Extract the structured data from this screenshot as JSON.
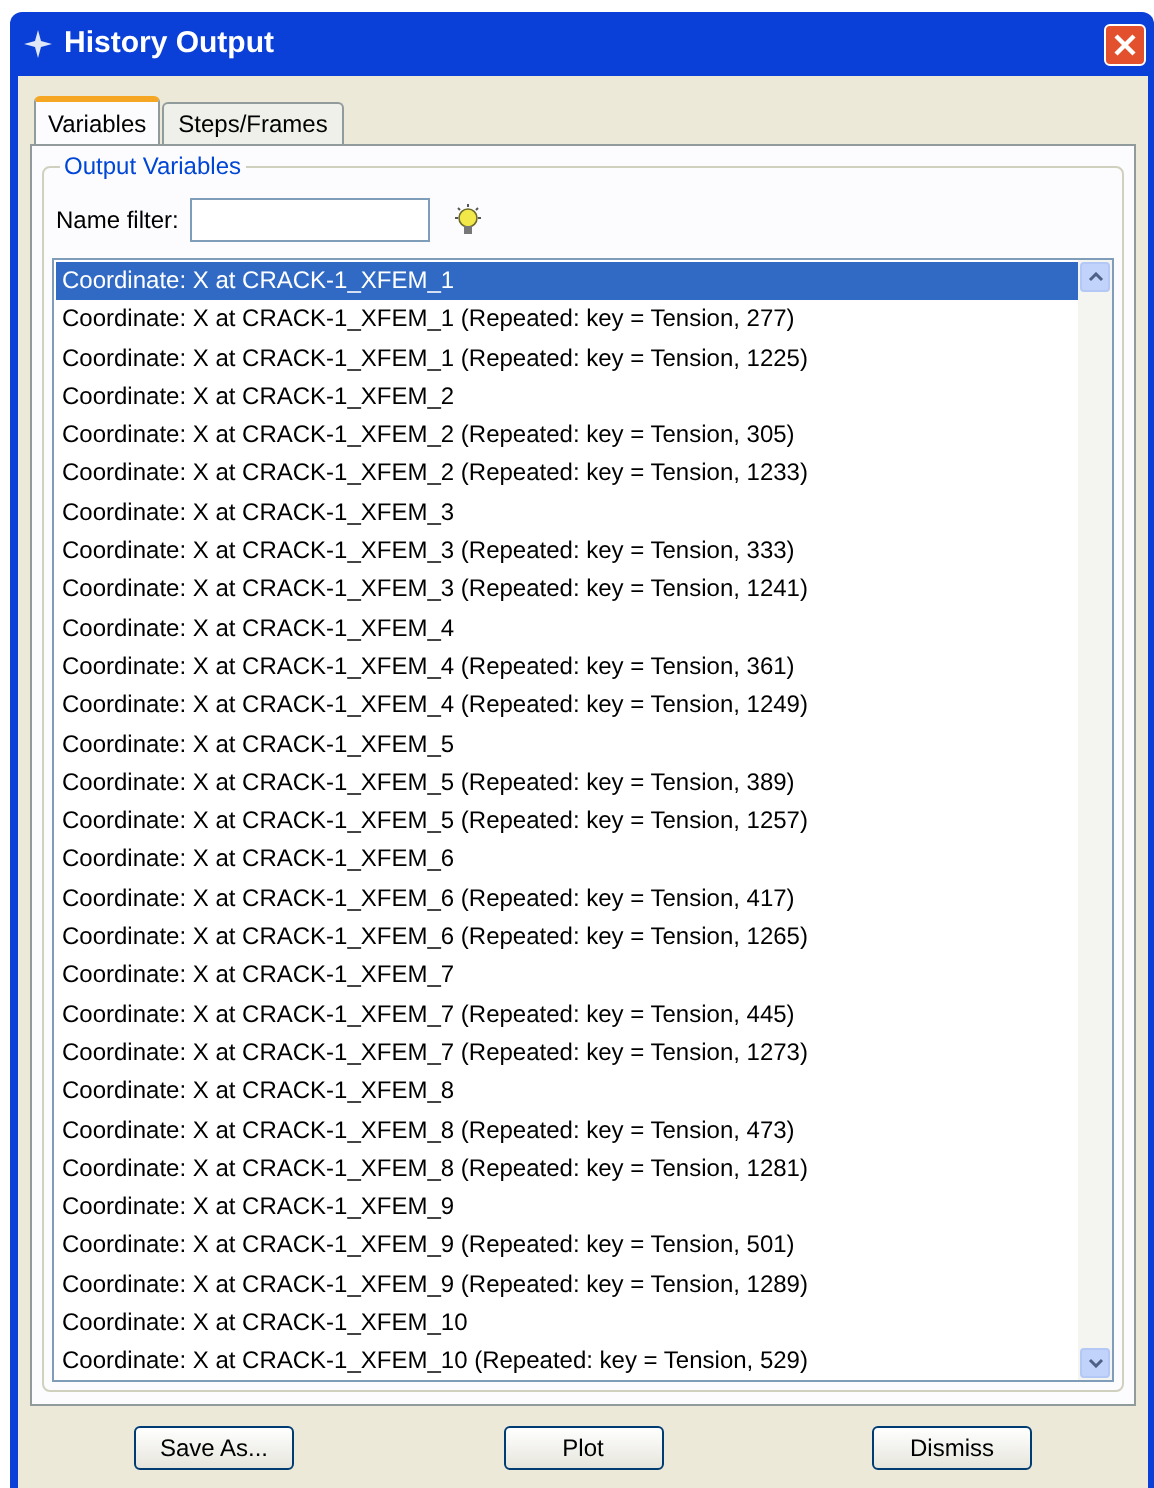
{
  "window": {
    "title": "History Output"
  },
  "tabs": [
    {
      "label": "Variables",
      "selected": true
    },
    {
      "label": "Steps/Frames",
      "selected": false
    }
  ],
  "group": {
    "title": "Output Variables"
  },
  "name_filter": {
    "label": "Name filter:"
  },
  "list": [
    {
      "text": "Coordinate: X at CRACK-1_XFEM_1",
      "selected": true
    },
    {
      "text": "Coordinate: X at CRACK-1_XFEM_1 (Repeated: key = Tension, 277)",
      "selected": false
    },
    {
      "text": "Coordinate: X at CRACK-1_XFEM_1 (Repeated: key = Tension, 1225)",
      "selected": false
    },
    {
      "text": "Coordinate: X at CRACK-1_XFEM_2",
      "selected": false
    },
    {
      "text": "Coordinate: X at CRACK-1_XFEM_2 (Repeated: key = Tension, 305)",
      "selected": false
    },
    {
      "text": "Coordinate: X at CRACK-1_XFEM_2 (Repeated: key = Tension, 1233)",
      "selected": false
    },
    {
      "text": "Coordinate: X at CRACK-1_XFEM_3",
      "selected": false
    },
    {
      "text": "Coordinate: X at CRACK-1_XFEM_3 (Repeated: key = Tension, 333)",
      "selected": false
    },
    {
      "text": "Coordinate: X at CRACK-1_XFEM_3 (Repeated: key = Tension, 1241)",
      "selected": false
    },
    {
      "text": "Coordinate: X at CRACK-1_XFEM_4",
      "selected": false
    },
    {
      "text": "Coordinate: X at CRACK-1_XFEM_4 (Repeated: key = Tension, 361)",
      "selected": false
    },
    {
      "text": "Coordinate: X at CRACK-1_XFEM_4 (Repeated: key = Tension, 1249)",
      "selected": false
    },
    {
      "text": "Coordinate: X at CRACK-1_XFEM_5",
      "selected": false
    },
    {
      "text": "Coordinate: X at CRACK-1_XFEM_5 (Repeated: key = Tension, 389)",
      "selected": false
    },
    {
      "text": "Coordinate: X at CRACK-1_XFEM_5 (Repeated: key = Tension, 1257)",
      "selected": false
    },
    {
      "text": "Coordinate: X at CRACK-1_XFEM_6",
      "selected": false
    },
    {
      "text": "Coordinate: X at CRACK-1_XFEM_6 (Repeated: key = Tension, 417)",
      "selected": false
    },
    {
      "text": "Coordinate: X at CRACK-1_XFEM_6 (Repeated: key = Tension, 1265)",
      "selected": false
    },
    {
      "text": "Coordinate: X at CRACK-1_XFEM_7",
      "selected": false
    },
    {
      "text": "Coordinate: X at CRACK-1_XFEM_7 (Repeated: key = Tension, 445)",
      "selected": false
    },
    {
      "text": "Coordinate: X at CRACK-1_XFEM_7 (Repeated: key = Tension, 1273)",
      "selected": false
    },
    {
      "text": "Coordinate: X at CRACK-1_XFEM_8",
      "selected": false
    },
    {
      "text": "Coordinate: X at CRACK-1_XFEM_8 (Repeated: key = Tension, 473)",
      "selected": false
    },
    {
      "text": "Coordinate: X at CRACK-1_XFEM_8 (Repeated: key = Tension, 1281)",
      "selected": false
    },
    {
      "text": "Coordinate: X at CRACK-1_XFEM_9",
      "selected": false
    },
    {
      "text": "Coordinate: X at CRACK-1_XFEM_9 (Repeated: key = Tension, 501)",
      "selected": false
    },
    {
      "text": "Coordinate: X at CRACK-1_XFEM_9 (Repeated: key = Tension, 1289)",
      "selected": false
    },
    {
      "text": "Coordinate: X at CRACK-1_XFEM_10",
      "selected": false
    },
    {
      "text": "Coordinate: X at CRACK-1_XFEM_10 (Repeated: key = Tension, 529)",
      "selected": false
    }
  ],
  "buttons": [
    "Save As...",
    "Plot",
    "Dismiss"
  ]
}
